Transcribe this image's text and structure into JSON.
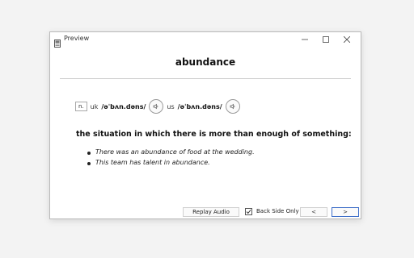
{
  "window": {
    "title": "Preview",
    "controls": {
      "minimize": "—",
      "maximize": "☐",
      "close": "✕"
    }
  },
  "card": {
    "word": "abundance",
    "part_of_speech": "n.",
    "pronunciations": [
      {
        "region": "uk",
        "ipa": "/əˈbʌn.dəns/"
      },
      {
        "region": "us",
        "ipa": "/əˈbʌn.dəns/"
      }
    ],
    "definition": "the situation in which there is more than enough of something:",
    "examples": [
      "There was an abundance of food at the wedding.",
      "This team has talent in abundance."
    ]
  },
  "bottom_bar": {
    "replay_label": "Replay Audio",
    "back_side_only_label": "Back Side Only",
    "back_side_only_checked": true,
    "prev_label": "<",
    "next_label": ">"
  },
  "colors": {
    "focus_accent": "#3b6cc8"
  }
}
